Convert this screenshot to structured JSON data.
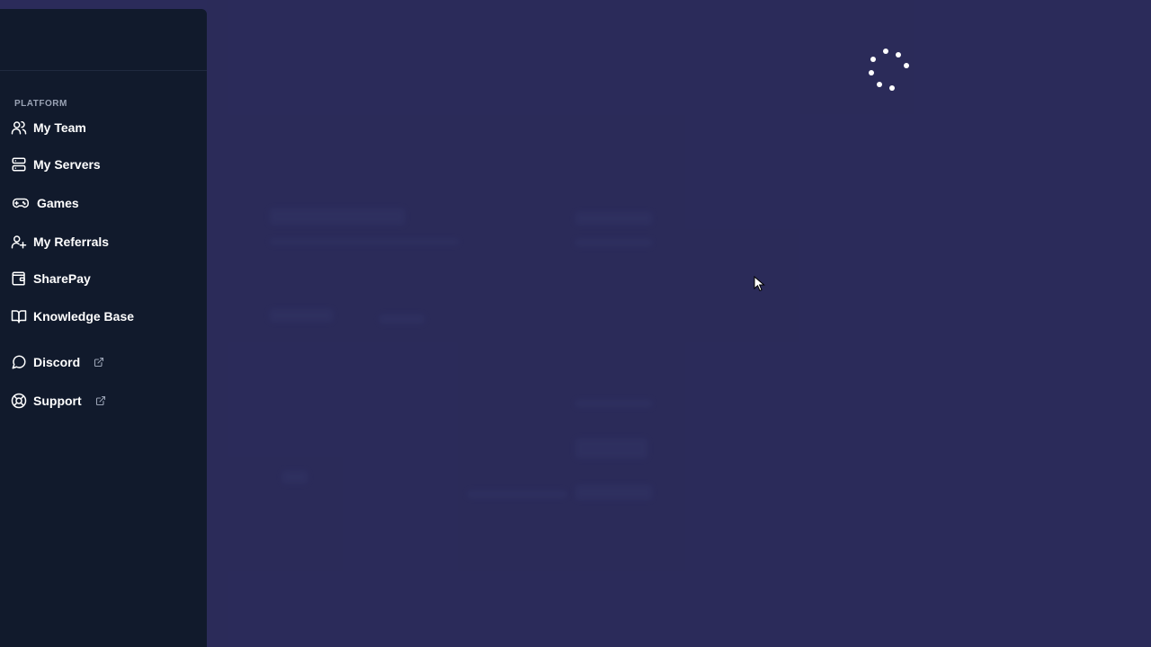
{
  "sidebar": {
    "section_label": "PLATFORM",
    "items": [
      {
        "label": "My Team",
        "icon": "users-icon",
        "external": false
      },
      {
        "label": "My Servers",
        "icon": "server-icon",
        "external": false
      },
      {
        "label": "Games",
        "icon": "gamepad-icon",
        "external": false
      },
      {
        "label": "My Referrals",
        "icon": "user-plus-icon",
        "external": false
      },
      {
        "label": "SharePay",
        "icon": "wallet-icon",
        "external": false
      },
      {
        "label": "Knowledge Base",
        "icon": "book-icon",
        "external": false
      },
      {
        "label": "Discord",
        "icon": "chat-bubble-icon",
        "external": true
      },
      {
        "label": "Support",
        "icon": "lifebuoy-icon",
        "external": true
      }
    ]
  },
  "main": {
    "state": "loading",
    "spinner_icon": "loading-spinner-icon"
  },
  "colors": {
    "sidebar_bg": "#111a2c",
    "main_bg": "#2b2b5a",
    "text": "#ffffff",
    "section_label": "#9aa3b5"
  }
}
